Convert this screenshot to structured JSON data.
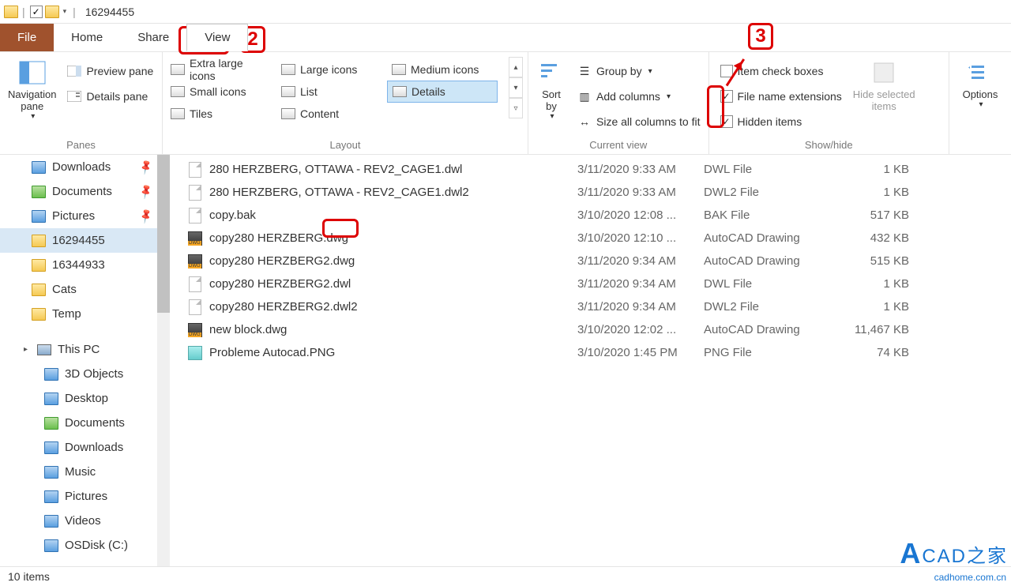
{
  "title": "16294455",
  "tabs": {
    "file": "File",
    "home": "Home",
    "share": "Share",
    "view": "View"
  },
  "ribbon": {
    "panes_label": "Panes",
    "nav_pane": "Navigation\npane",
    "preview": "Preview pane",
    "details": "Details pane",
    "layout_label": "Layout",
    "layouts": [
      "Extra large icons",
      "Large icons",
      "Medium icons",
      "Small icons",
      "List",
      "Details",
      "Tiles",
      "Content"
    ],
    "sort": "Sort\nby",
    "currentview_label": "Current view",
    "groupby": "Group by",
    "addcols": "Add columns",
    "sizeall": "Size all columns to fit",
    "showhide_label": "Show/hide",
    "itemcheck": "Item check boxes",
    "filext": "File name extensions",
    "hiddenitems": "Hidden items",
    "hidesel": "Hide selected\nitems",
    "options": "Options"
  },
  "nav": {
    "quick": [
      {
        "label": "Downloads",
        "pin": true,
        "cls": "folder-b"
      },
      {
        "label": "Documents",
        "pin": true,
        "cls": "folder-g"
      },
      {
        "label": "Pictures",
        "pin": true,
        "cls": "folder-b"
      },
      {
        "label": "16294455",
        "pin": false,
        "cls": "folder-y",
        "selected": true
      },
      {
        "label": "16344933",
        "pin": false,
        "cls": "folder-y"
      },
      {
        "label": "Cats",
        "pin": false,
        "cls": "folder-y"
      },
      {
        "label": "Temp",
        "pin": false,
        "cls": "folder-y"
      }
    ],
    "thispc_label": "This PC",
    "thispc": [
      {
        "label": "3D Objects",
        "cls": "folder-b"
      },
      {
        "label": "Desktop",
        "cls": "folder-b"
      },
      {
        "label": "Documents",
        "cls": "folder-g"
      },
      {
        "label": "Downloads",
        "cls": "folder-b"
      },
      {
        "label": "Music",
        "cls": "folder-b"
      },
      {
        "label": "Pictures",
        "cls": "folder-b"
      },
      {
        "label": "Videos",
        "cls": "folder-b"
      },
      {
        "label": "OSDisk (C:)",
        "cls": "folder-b"
      }
    ]
  },
  "files": [
    {
      "icon": "doc",
      "name": "280 HERZBERG, OTTAWA - REV2_CAGE1.dwl",
      "date": "3/11/2020 9:33 AM",
      "type": "DWL File",
      "size": "1 KB"
    },
    {
      "icon": "doc",
      "name": "280 HERZBERG, OTTAWA - REV2_CAGE1.dwl2",
      "date": "3/11/2020 9:33 AM",
      "type": "DWL2 File",
      "size": "1 KB"
    },
    {
      "icon": "doc",
      "name": "copy.bak",
      "date": "3/10/2020 12:08 ...",
      "type": "BAK File",
      "size": "517 KB"
    },
    {
      "icon": "dwg",
      "name": "copy280 HERZBERG.dwg",
      "date": "3/10/2020 12:10 ...",
      "type": "AutoCAD Drawing",
      "size": "432 KB"
    },
    {
      "icon": "dwg",
      "name": "copy280 HERZBERG2.dwg",
      "date": "3/11/2020 9:34 AM",
      "type": "AutoCAD Drawing",
      "size": "515 KB"
    },
    {
      "icon": "doc",
      "name": "copy280 HERZBERG2.dwl",
      "date": "3/11/2020 9:34 AM",
      "type": "DWL File",
      "size": "1 KB"
    },
    {
      "icon": "doc",
      "name": "copy280 HERZBERG2.dwl2",
      "date": "3/11/2020 9:34 AM",
      "type": "DWL2 File",
      "size": "1 KB"
    },
    {
      "icon": "dwg",
      "name": "new block.dwg",
      "date": "3/10/2020 12:02 ...",
      "type": "AutoCAD Drawing",
      "size": "11,467 KB"
    },
    {
      "icon": "png",
      "name": "Probleme Autocad.PNG",
      "date": "3/10/2020 1:45 PM",
      "type": "PNG File",
      "size": "74 KB"
    }
  ],
  "status": "10 items",
  "callouts": {
    "c2": "2",
    "c3": "3"
  },
  "watermark": {
    "main": "CAD之家",
    "url": "cadhome.com.cn"
  }
}
